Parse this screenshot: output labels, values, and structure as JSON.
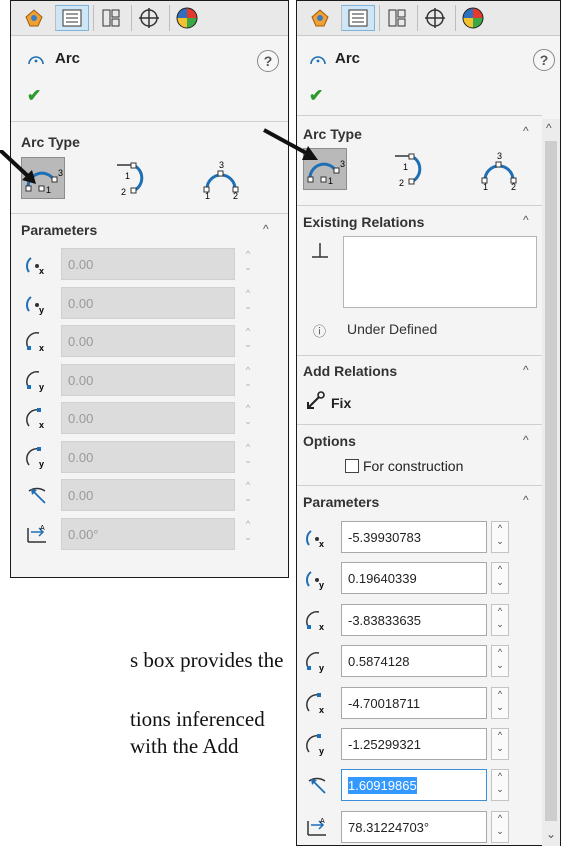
{
  "left_panel": {
    "title": "Arc",
    "help": "?",
    "arc_type_label": "Arc Type",
    "parameters_label": "Parameters",
    "params": [
      {
        "icon": "center-x-icon",
        "value": "0.00"
      },
      {
        "icon": "center-y-icon",
        "value": "0.00"
      },
      {
        "icon": "start-x-icon",
        "value": "0.00"
      },
      {
        "icon": "start-y-icon",
        "value": "0.00"
      },
      {
        "icon": "end-x-icon",
        "value": "0.00"
      },
      {
        "icon": "end-y-icon",
        "value": "0.00"
      },
      {
        "icon": "radius-icon",
        "value": "0.00"
      },
      {
        "icon": "angle-icon",
        "value": "0.00°"
      }
    ]
  },
  "right_panel": {
    "title": "Arc",
    "help": "?",
    "arc_type_label": "Arc Type",
    "existing_relations_label": "Existing Relations",
    "status": "Under Defined",
    "add_relations_label": "Add Relations",
    "fix_label": "Fix",
    "options_label": "Options",
    "construction_label": "For construction",
    "parameters_label": "Parameters",
    "params": [
      {
        "icon": "center-x-icon",
        "value": "-5.39930783"
      },
      {
        "icon": "center-y-icon",
        "value": "0.19640339"
      },
      {
        "icon": "start-x-icon",
        "value": "-3.83833635"
      },
      {
        "icon": "start-y-icon",
        "value": "0.5874128"
      },
      {
        "icon": "end-x-icon",
        "value": "-4.70018711"
      },
      {
        "icon": "end-y-icon",
        "value": "-1.25299321"
      },
      {
        "icon": "radius-icon",
        "value": "1.60919865"
      },
      {
        "icon": "angle-icon",
        "value": "78.31224703°"
      }
    ]
  },
  "arc_types": [
    "centerpoint-arc",
    "tangent-arc",
    "3-point-arc"
  ],
  "arc_type_labels": {
    "a": "1",
    "b": "2",
    "c": "3"
  },
  "caption": {
    "line1": "s box provides the",
    "line2": "tions inferenced",
    "line3": "with the Add"
  },
  "colors": {
    "accent": "#1e6fb5",
    "check": "#2e9a2e",
    "selected": "#b9b9b9"
  }
}
